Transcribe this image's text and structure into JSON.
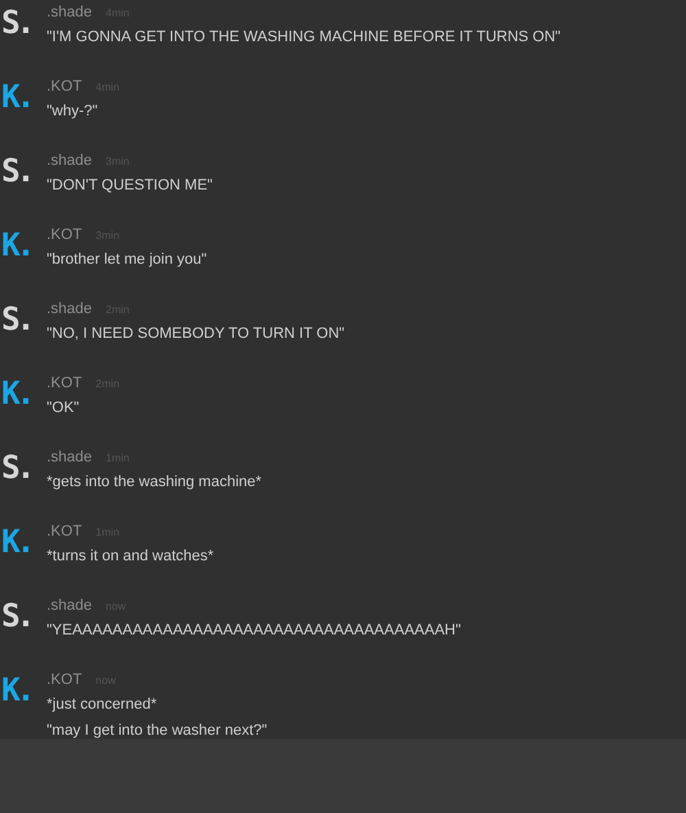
{
  "messages": [
    {
      "avatar": "S.",
      "color": "#d6d6d6",
      "author": ".shade",
      "time": "4min",
      "lines": [
        "\"I'M GONNA GET INTO THE WASHING MACHINE BEFORE IT TURNS ON\""
      ]
    },
    {
      "avatar": "K.",
      "color": "#1ba6e4",
      "author": ".KOT",
      "time": "4min",
      "lines": [
        "\"why-?\""
      ]
    },
    {
      "avatar": "S.",
      "color": "#d6d6d6",
      "author": ".shade",
      "time": "3min",
      "lines": [
        "\"DON'T QUESTION ME\""
      ]
    },
    {
      "avatar": "K.",
      "color": "#1ba6e4",
      "author": ".KOT",
      "time": "3min",
      "lines": [
        "\"brother let me join you\""
      ]
    },
    {
      "avatar": "S.",
      "color": "#d6d6d6",
      "author": ".shade",
      "time": "2min",
      "lines": [
        "\"NO, I NEED SOMEBODY TO TURN IT ON\""
      ]
    },
    {
      "avatar": "K.",
      "color": "#1ba6e4",
      "author": ".KOT",
      "time": "2min",
      "lines": [
        "\"OK\""
      ]
    },
    {
      "avatar": "S.",
      "color": "#d6d6d6",
      "author": ".shade",
      "time": "1min",
      "lines": [
        "*gets into the washing machine*"
      ]
    },
    {
      "avatar": "K.",
      "color": "#1ba6e4",
      "author": ".KOT",
      "time": "1min",
      "lines": [
        "*turns it on and watches*"
      ]
    },
    {
      "avatar": "S.",
      "color": "#d6d6d6",
      "author": ".shade",
      "time": "now",
      "lines": [
        "\"YEAAAAAAAAAAAAAAAAAAAAAAAAAAAAAAAAAAAAAH\""
      ]
    },
    {
      "avatar": "K.",
      "color": "#1ba6e4",
      "author": ".KOT",
      "time": "now",
      "lines": [
        "*just concerned*",
        "\"may I get into the washer next?\""
      ]
    }
  ]
}
